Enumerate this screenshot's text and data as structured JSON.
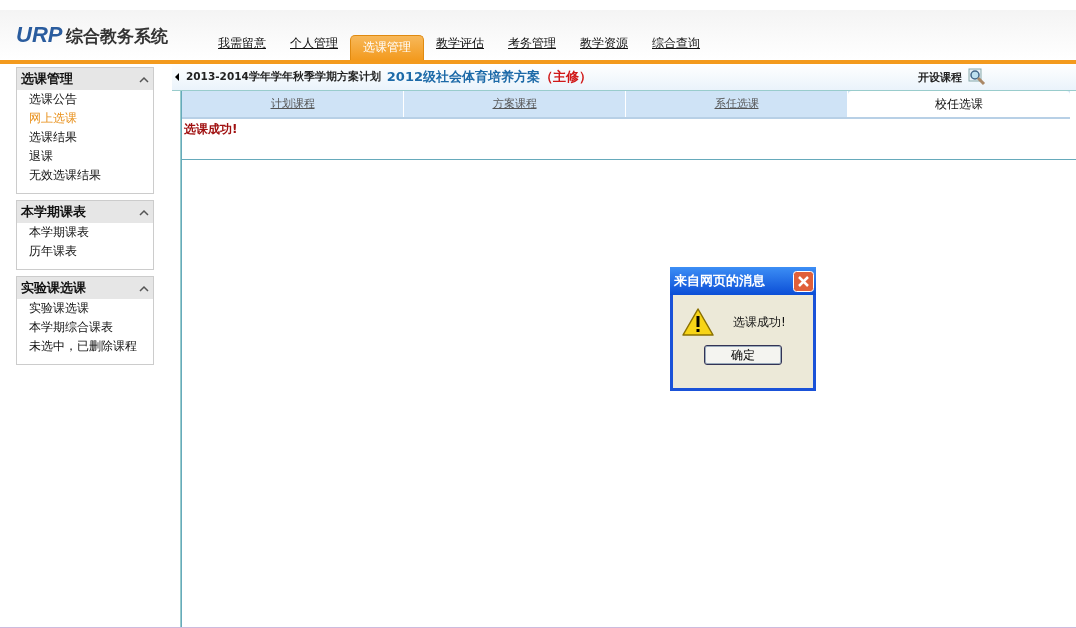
{
  "logo": {
    "mark": "URP",
    "title": "综合教务系统"
  },
  "nav": [
    {
      "label": "我需留意",
      "selected": false
    },
    {
      "label": "个人管理",
      "selected": false
    },
    {
      "label": "选课管理",
      "selected": true
    },
    {
      "label": "教学评估",
      "selected": false
    },
    {
      "label": "考务管理",
      "selected": false
    },
    {
      "label": "教学资源",
      "selected": false
    },
    {
      "label": "综合查询",
      "selected": false
    }
  ],
  "sidebar": [
    {
      "title": "选课管理",
      "expanded": true,
      "items": [
        {
          "label": "选课公告",
          "selected": false
        },
        {
          "label": "网上选课",
          "selected": true
        },
        {
          "label": "选课结果",
          "selected": false
        },
        {
          "label": "退课",
          "selected": false
        },
        {
          "label": "无效选课结果",
          "selected": false
        }
      ]
    },
    {
      "title": "本学期课表",
      "expanded": true,
      "items": [
        {
          "label": "本学期课表",
          "selected": false
        },
        {
          "label": "历年课表",
          "selected": false
        }
      ]
    },
    {
      "title": "实验课选课",
      "expanded": true,
      "items": [
        {
          "label": "实验课选课",
          "selected": false
        },
        {
          "label": "本学期综合课表",
          "selected": false
        },
        {
          "label": "未选中，已删除课程",
          "selected": false
        }
      ]
    }
  ],
  "plan_bar": {
    "term": "2013-2014学年学年秋季学期方案计划",
    "plan": "2012级社会体育培养方案",
    "major": "（主修）",
    "link": "开设课程"
  },
  "tabs": [
    {
      "label": "计划课程",
      "selected": false
    },
    {
      "label": "方案课程",
      "selected": false
    },
    {
      "label": "系任选课",
      "selected": false
    },
    {
      "label": "校任选课",
      "selected": true
    }
  ],
  "message": "选课成功!",
  "dialog": {
    "title": "来自网页的消息",
    "text": "选课成功!",
    "button": "确定"
  }
}
